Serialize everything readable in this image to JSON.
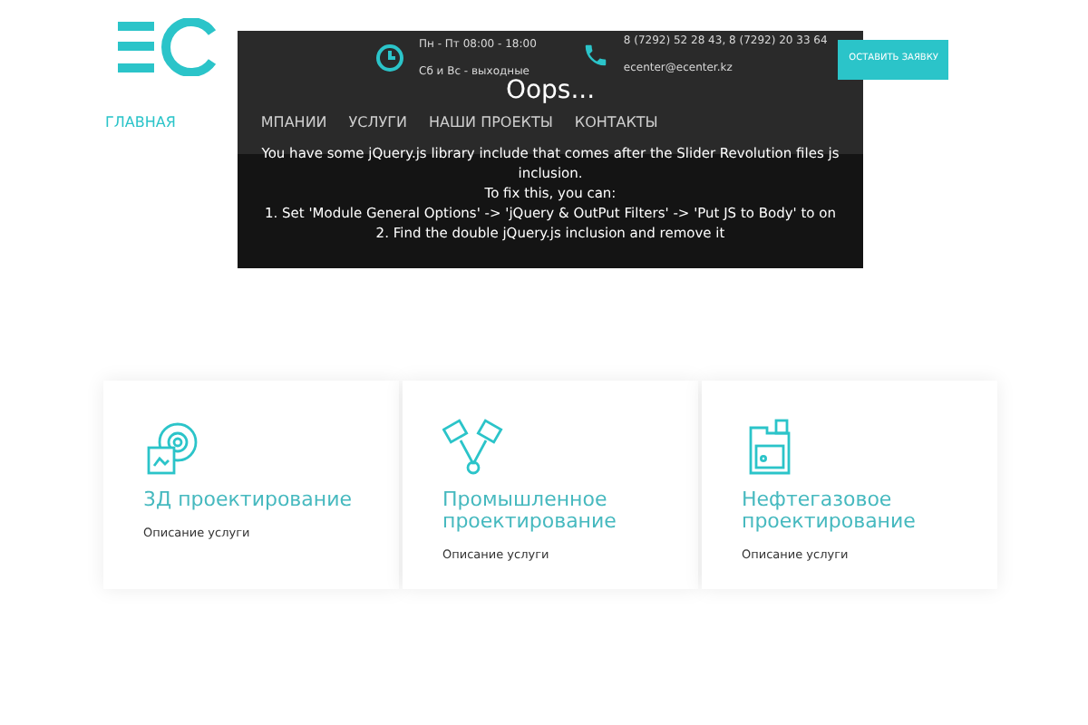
{
  "header": {
    "hours": [
      "Пн - Пт 08:00 - 18:00",
      "Сб и Вс - выходные"
    ],
    "contacts": [
      "8 (7292) 52 28 43, 8 (7292) 20 33 64",
      "ecenter@ecenter.kz"
    ],
    "cta_button": "ОСТАВИТЬ ЗАЯВКУ"
  },
  "nav": [
    {
      "label": "ГЛАВНАЯ",
      "selected": true
    },
    {
      "label": "МПАНИИ",
      "selected": false
    },
    {
      "label": "УСЛУГИ",
      "selected": false
    },
    {
      "label": "НАШИ ПРОЕКТЫ",
      "selected": false
    },
    {
      "label": "КОНТАКТЫ",
      "selected": false
    }
  ],
  "error": {
    "title": "Oops...",
    "lines": [
      "You have some jQuery.js library include that comes after the Slider Revolution files js inclusion.",
      "To fix this, you can:",
      "1. Set 'Module General Options' -> 'jQuery & OutPut Filters' -> 'Put JS to Body' to on",
      "2. Find the double jQuery.js inclusion and remove it"
    ]
  },
  "services": [
    {
      "kind": "gear",
      "title": "3Д проектирование",
      "description": "Описание услуги"
    },
    {
      "kind": "pistons",
      "title": "Промышленное проектирование",
      "description": "Описание услуги"
    },
    {
      "kind": "canister",
      "title": "Нефтегазовое проектирование",
      "description": "Описание услуги"
    }
  ]
}
